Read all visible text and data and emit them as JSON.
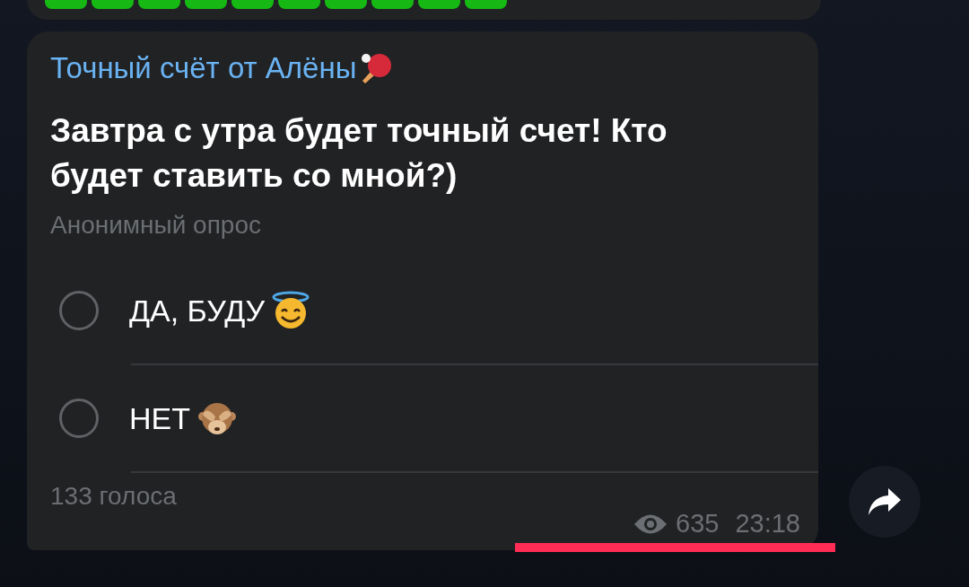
{
  "poll": {
    "author": "Точный счёт от Алёны",
    "question": "Завтра с утра будет точный счет! Кто будет ставить со мной?)",
    "type_label": "Анонимный опрос",
    "options": [
      {
        "label": "ДА, БУДУ",
        "selected": false
      },
      {
        "label": "НЕТ",
        "selected": false
      }
    ],
    "votes": "133 голоса",
    "views": "635",
    "time": "23:18"
  }
}
